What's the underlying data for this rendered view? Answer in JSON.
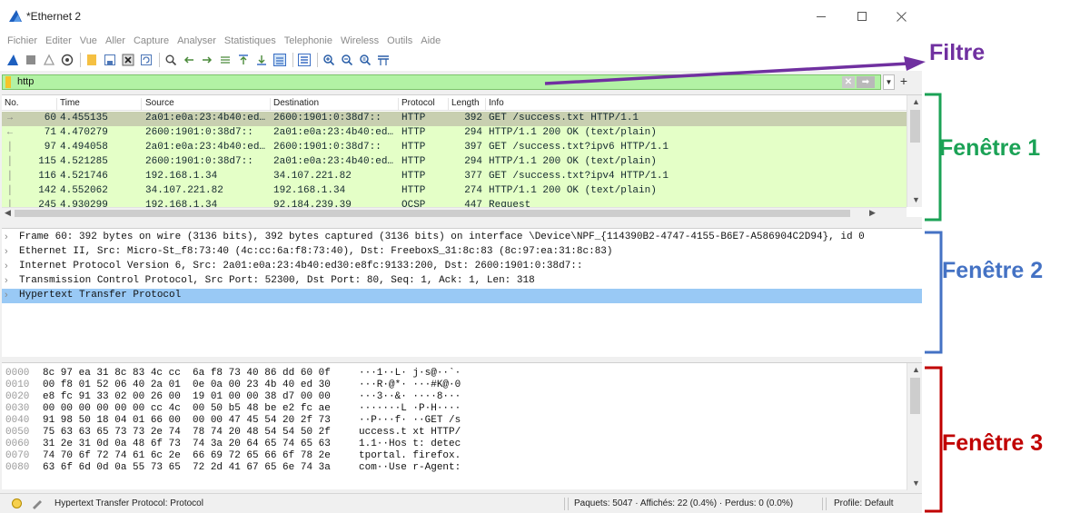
{
  "window": {
    "title": "*Ethernet 2"
  },
  "menu": [
    "Fichier",
    "Editer",
    "Vue",
    "Aller",
    "Capture",
    "Analyser",
    "Statistiques",
    "Telephonie",
    "Wireless",
    "Outils",
    "Aide"
  ],
  "filter": {
    "value": "http"
  },
  "packet_list": {
    "columns": [
      "No.",
      "Time",
      "Source",
      "Destination",
      "Protocol",
      "Length",
      "Info"
    ],
    "rows": [
      {
        "no": "60",
        "time": "4.455135",
        "src": "2a01:e0a:23:4b40:ed…",
        "dst": "2600:1901:0:38d7::",
        "proto": "HTTP",
        "len": "392",
        "info": "GET /success.txt HTTP/1.1"
      },
      {
        "no": "71",
        "time": "4.470279",
        "src": "2600:1901:0:38d7::",
        "dst": "2a01:e0a:23:4b40:ed…",
        "proto": "HTTP",
        "len": "294",
        "info": "HTTP/1.1 200 OK  (text/plain)"
      },
      {
        "no": "97",
        "time": "4.494058",
        "src": "2a01:e0a:23:4b40:ed…",
        "dst": "2600:1901:0:38d7::",
        "proto": "HTTP",
        "len": "397",
        "info": "GET /success.txt?ipv6 HTTP/1.1"
      },
      {
        "no": "115",
        "time": "4.521285",
        "src": "2600:1901:0:38d7::",
        "dst": "2a01:e0a:23:4b40:ed…",
        "proto": "HTTP",
        "len": "294",
        "info": "HTTP/1.1 200 OK  (text/plain)"
      },
      {
        "no": "116",
        "time": "4.521746",
        "src": "192.168.1.34",
        "dst": "34.107.221.82",
        "proto": "HTTP",
        "len": "377",
        "info": "GET /success.txt?ipv4 HTTP/1.1"
      },
      {
        "no": "142",
        "time": "4.552062",
        "src": "34.107.221.82",
        "dst": "192.168.1.34",
        "proto": "HTTP",
        "len": "274",
        "info": "HTTP/1.1 200 OK  (text/plain)"
      },
      {
        "no": "245",
        "time": "4.930299",
        "src": "192.168.1.34",
        "dst": "92.184.239.39",
        "proto": "OCSP",
        "len": "447",
        "info": "Request"
      }
    ]
  },
  "details": [
    "Frame 60: 392 bytes on wire (3136 bits), 392 bytes captured (3136 bits) on interface \\Device\\NPF_{114390B2-4747-4155-B6E7-A586904C2D94}, id 0",
    "Ethernet II, Src: Micro-St_f8:73:40 (4c:cc:6a:f8:73:40), Dst: FreeboxS_31:8c:83 (8c:97:ea:31:8c:83)",
    "Internet Protocol Version 6, Src: 2a01:e0a:23:4b40:ed30:e8fc:9133:200, Dst: 2600:1901:0:38d7::",
    "Transmission Control Protocol, Src Port: 52300, Dst Port: 80, Seq: 1, Ack: 1, Len: 318",
    "Hypertext Transfer Protocol"
  ],
  "bytes": [
    {
      "off": "0000",
      "hex": "8c 97 ea 31 8c 83 4c cc  6a f8 73 40 86 dd 60 0f",
      "ascii": "···1··L· j·s@··`·"
    },
    {
      "off": "0010",
      "hex": "00 f8 01 52 06 40 2a 01  0e 0a 00 23 4b 40 ed 30",
      "ascii": "···R·@*· ···#K@·0"
    },
    {
      "off": "0020",
      "hex": "e8 fc 91 33 02 00 26 00  19 01 00 00 38 d7 00 00",
      "ascii": "···3··&· ····8···"
    },
    {
      "off": "0030",
      "hex": "00 00 00 00 00 00 cc 4c  00 50 b5 48 be e2 fc ae",
      "ascii": "·······L ·P·H····"
    },
    {
      "off": "0040",
      "hex": "91 98 50 18 04 01 66 00  00 00 47 45 54 20 2f 73",
      "ascii": "··P···f· ··GET /s"
    },
    {
      "off": "0050",
      "hex": "75 63 63 65 73 73 2e 74  78 74 20 48 54 54 50 2f",
      "ascii": "uccess.t xt HTTP/"
    },
    {
      "off": "0060",
      "hex": "31 2e 31 0d 0a 48 6f 73  74 3a 20 64 65 74 65 63",
      "ascii": "1.1··Hos t: detec"
    },
    {
      "off": "0070",
      "hex": "74 70 6f 72 74 61 6c 2e  66 69 72 65 66 6f 78 2e",
      "ascii": "tportal. firefox."
    },
    {
      "off": "0080",
      "hex": "63 6f 6d 0d 0a 55 73 65  72 2d 41 67 65 6e 74 3a",
      "ascii": "com··Use r-Agent:"
    }
  ],
  "status": {
    "field": "Hypertext Transfer Protocol: Protocol",
    "packets": "Paquets: 5047 · Affichés: 22 (0.4%) · Perdus: 0 (0.0%)",
    "profile": "Profile: Default"
  },
  "annotations": {
    "filter": "Filtre",
    "pane1": "Fenêtre 1",
    "pane2": "Fenêtre 2",
    "pane3": "Fenêtre 3"
  },
  "colors": {
    "filter_valid": "#b2f2a4",
    "http_row": "#e4ffc7",
    "selected_row": "#c8cfb0",
    "selected_detail": "#99c9f5",
    "annotation_filter": "#7030a0",
    "annotation_pane1": "#1ba256",
    "annotation_pane2": "#4472c4",
    "annotation_pane3": "#c00000"
  }
}
